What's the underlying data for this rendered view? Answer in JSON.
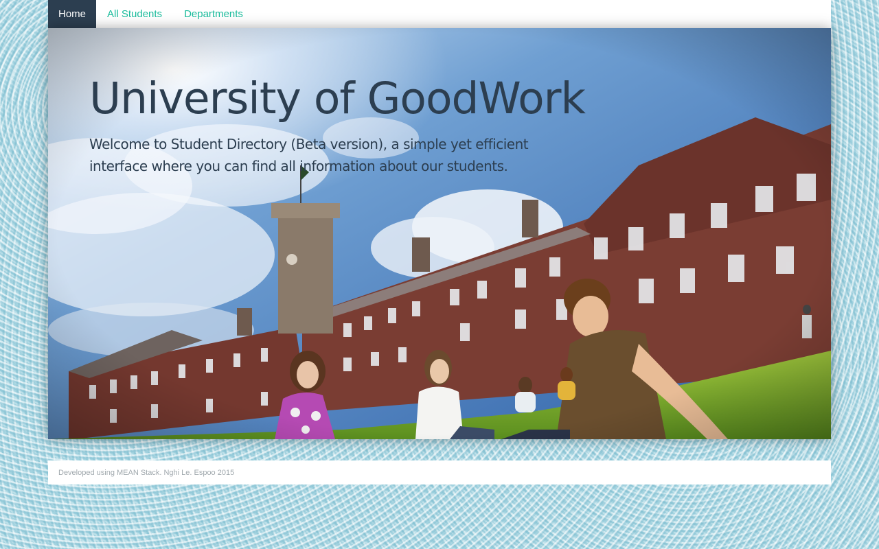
{
  "nav": {
    "items": [
      {
        "label": "Home",
        "active": true
      },
      {
        "label": "All Students",
        "active": false
      },
      {
        "label": "Departments",
        "active": false
      }
    ]
  },
  "hero": {
    "title": "University of GoodWork",
    "subtitle": "Welcome to Student Directory (Beta version), a simple yet efficient interface where you can find all information about our students.",
    "image": "campus-photo"
  },
  "footer": {
    "text": "Developed using MEAN Stack. Nghi Le. Espoo 2015"
  },
  "colors": {
    "accent": "#1abc9c",
    "nav_active_bg": "#2c3e50",
    "heading": "#2c3e50",
    "footer_text": "#a0a8ad"
  }
}
